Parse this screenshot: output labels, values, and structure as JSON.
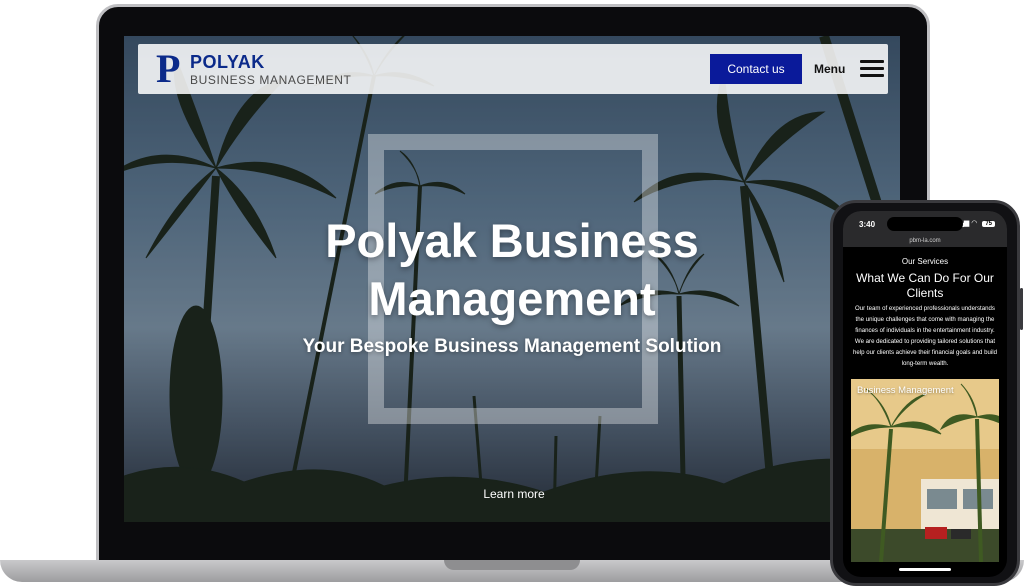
{
  "desktop_site": {
    "logo": {
      "mark": "P",
      "name": "POLYAK",
      "subtitle": "BUSINESS MANAGEMENT"
    },
    "header": {
      "contact_label": "Contact us",
      "menu_label": "Menu"
    },
    "hero": {
      "title": "Polyak Business Management",
      "subtitle": "Your Bespoke Business Management Solution",
      "cta": "Learn more"
    }
  },
  "mobile_site": {
    "status": {
      "time": "3:40",
      "battery": "75"
    },
    "url": "pbm-la.com",
    "section_eyebrow": "Our Services",
    "section_heading": "What We Can Do For Our Clients",
    "section_body": "Our team of experienced professionals understands the unique challenges that come with managing the finances of individuals in the entertainment industry. We are dedicated to providing tailored solutions that help our clients achieve their financial goals and build long-term wealth.",
    "card_title": "Business Management"
  },
  "colors": {
    "brand_blue": "#0b2a8a",
    "button_blue": "#0a1a9a"
  },
  "icons": [
    "hamburger-menu-icon",
    "wifi-icon",
    "signal-icon",
    "battery-icon"
  ]
}
